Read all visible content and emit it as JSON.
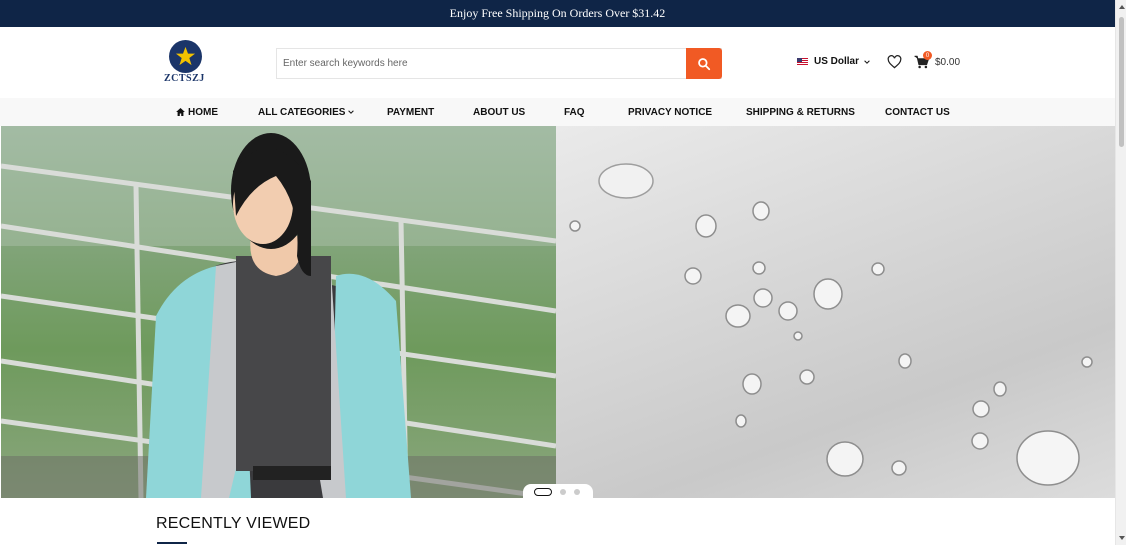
{
  "promo": {
    "text": "Enjoy Free Shipping On Orders Over $31.42"
  },
  "brand": {
    "name": "ZCTSZJ"
  },
  "search": {
    "placeholder": "Enter search keywords here",
    "value": ""
  },
  "currency": {
    "label": "US Dollar"
  },
  "cart": {
    "count": "0",
    "total": "$0.00"
  },
  "nav": {
    "items": [
      {
        "label": "HOME"
      },
      {
        "label": "ALL CATEGORIES"
      },
      {
        "label": "PAYMENT"
      },
      {
        "label": "ABOUT US"
      },
      {
        "label": "FAQ"
      },
      {
        "label": "PRIVACY NOTICE"
      },
      {
        "label": "SHIPPING & RETURNS"
      },
      {
        "label": "CONTACT US"
      }
    ]
  },
  "slider": {
    "total_slides": 3,
    "active_index": 0
  },
  "sections": {
    "recently_viewed": "RECENTLY VIEWED"
  },
  "colors": {
    "promo_bg": "#0f2547",
    "accent": "#f15a24",
    "brand_navy": "#1b3569",
    "star": "#f2c200"
  }
}
